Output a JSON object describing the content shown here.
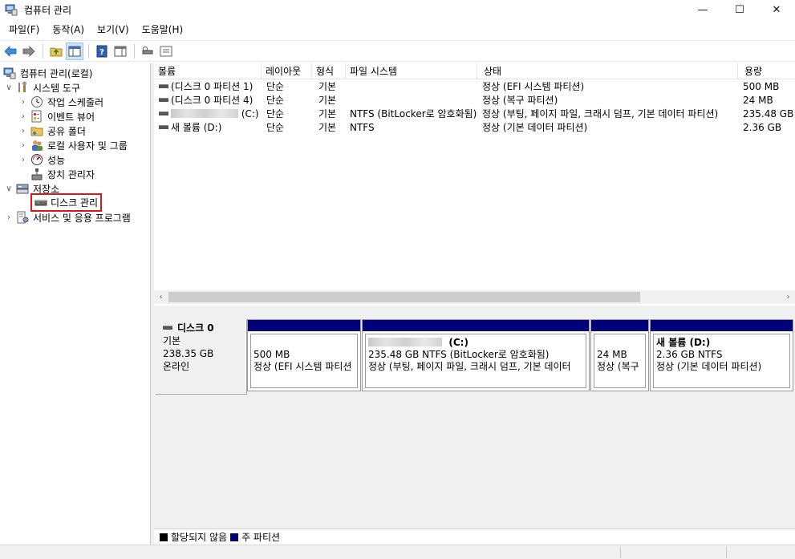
{
  "window": {
    "title": "컴퓨터 관리",
    "minimize_glyph": "—",
    "maximize_glyph": "☐",
    "close_glyph": "✕"
  },
  "menu": [
    "파일(F)",
    "동작(A)",
    "보기(V)",
    "도움말(H)"
  ],
  "tree": {
    "root": "컴퓨터 관리(로컬)",
    "system_tools": "시스템 도구",
    "task_scheduler": "작업 스케줄러",
    "event_viewer": "이벤트 뷰어",
    "shared_folders": "공유 폴더",
    "local_users": "로컬 사용자 및 그룹",
    "performance": "성능",
    "device_manager": "장치 관리자",
    "storage": "저장소",
    "disk_management": "디스크 관리",
    "services_apps": "서비스 및 응용 프로그램"
  },
  "volume_table": {
    "columns": [
      "볼륨",
      "레이아웃",
      "형식",
      "파일 시스템",
      "상태",
      "용량"
    ],
    "rows": [
      {
        "volume": "(디스크 0 파티션 1)",
        "layout": "단순",
        "type": "기본",
        "fs": "",
        "status": "정상 (EFI 시스템 파티션)",
        "capacity": "500 MB"
      },
      {
        "volume": "(디스크 0 파티션 4)",
        "layout": "단순",
        "type": "기본",
        "fs": "",
        "status": "정상 (복구 파티션)",
        "capacity": "24 MB"
      },
      {
        "volume": "(C:)",
        "layout": "단순",
        "type": "기본",
        "fs": "NTFS (BitLocker로 암호화됨)",
        "status": "정상 (부팅, 페이지 파일, 크래시 덤프, 기본 데이터 파티션)",
        "capacity": "235.48 GB"
      },
      {
        "volume": "새 볼륨 (D:)",
        "layout": "단순",
        "type": "기본",
        "fs": "NTFS",
        "status": "정상 (기본 데이터 파티션)",
        "capacity": "2.36 GB"
      }
    ]
  },
  "disk": {
    "name": "디스크 0",
    "type": "기본",
    "size": "238.35 GB",
    "state": "온라인",
    "partitions": [
      {
        "line1": "",
        "line2": "500 MB",
        "line3": "정상 (EFI 시스템 파티션"
      },
      {
        "line1": "(C:)",
        "line2": "235.48 GB NTFS (BitLocker로 암호화됨)",
        "line3": "정상 (부팅, 페이지 파일, 크래시 덤프, 기본 데이터"
      },
      {
        "line1": "",
        "line2": "24 MB",
        "line3": "정상 (복구"
      },
      {
        "line1": "새 볼륨  (D:)",
        "line2": "2.36 GB NTFS",
        "line3": "정상 (기본 데이터 파티션)"
      }
    ]
  },
  "legend": [
    {
      "label": "할당되지 않음",
      "color": "#000000"
    },
    {
      "label": "주 파티션",
      "color": "#00007b"
    }
  ],
  "colors": {
    "primary_partition": "#00007b",
    "selection_outline": "#e0161b"
  }
}
